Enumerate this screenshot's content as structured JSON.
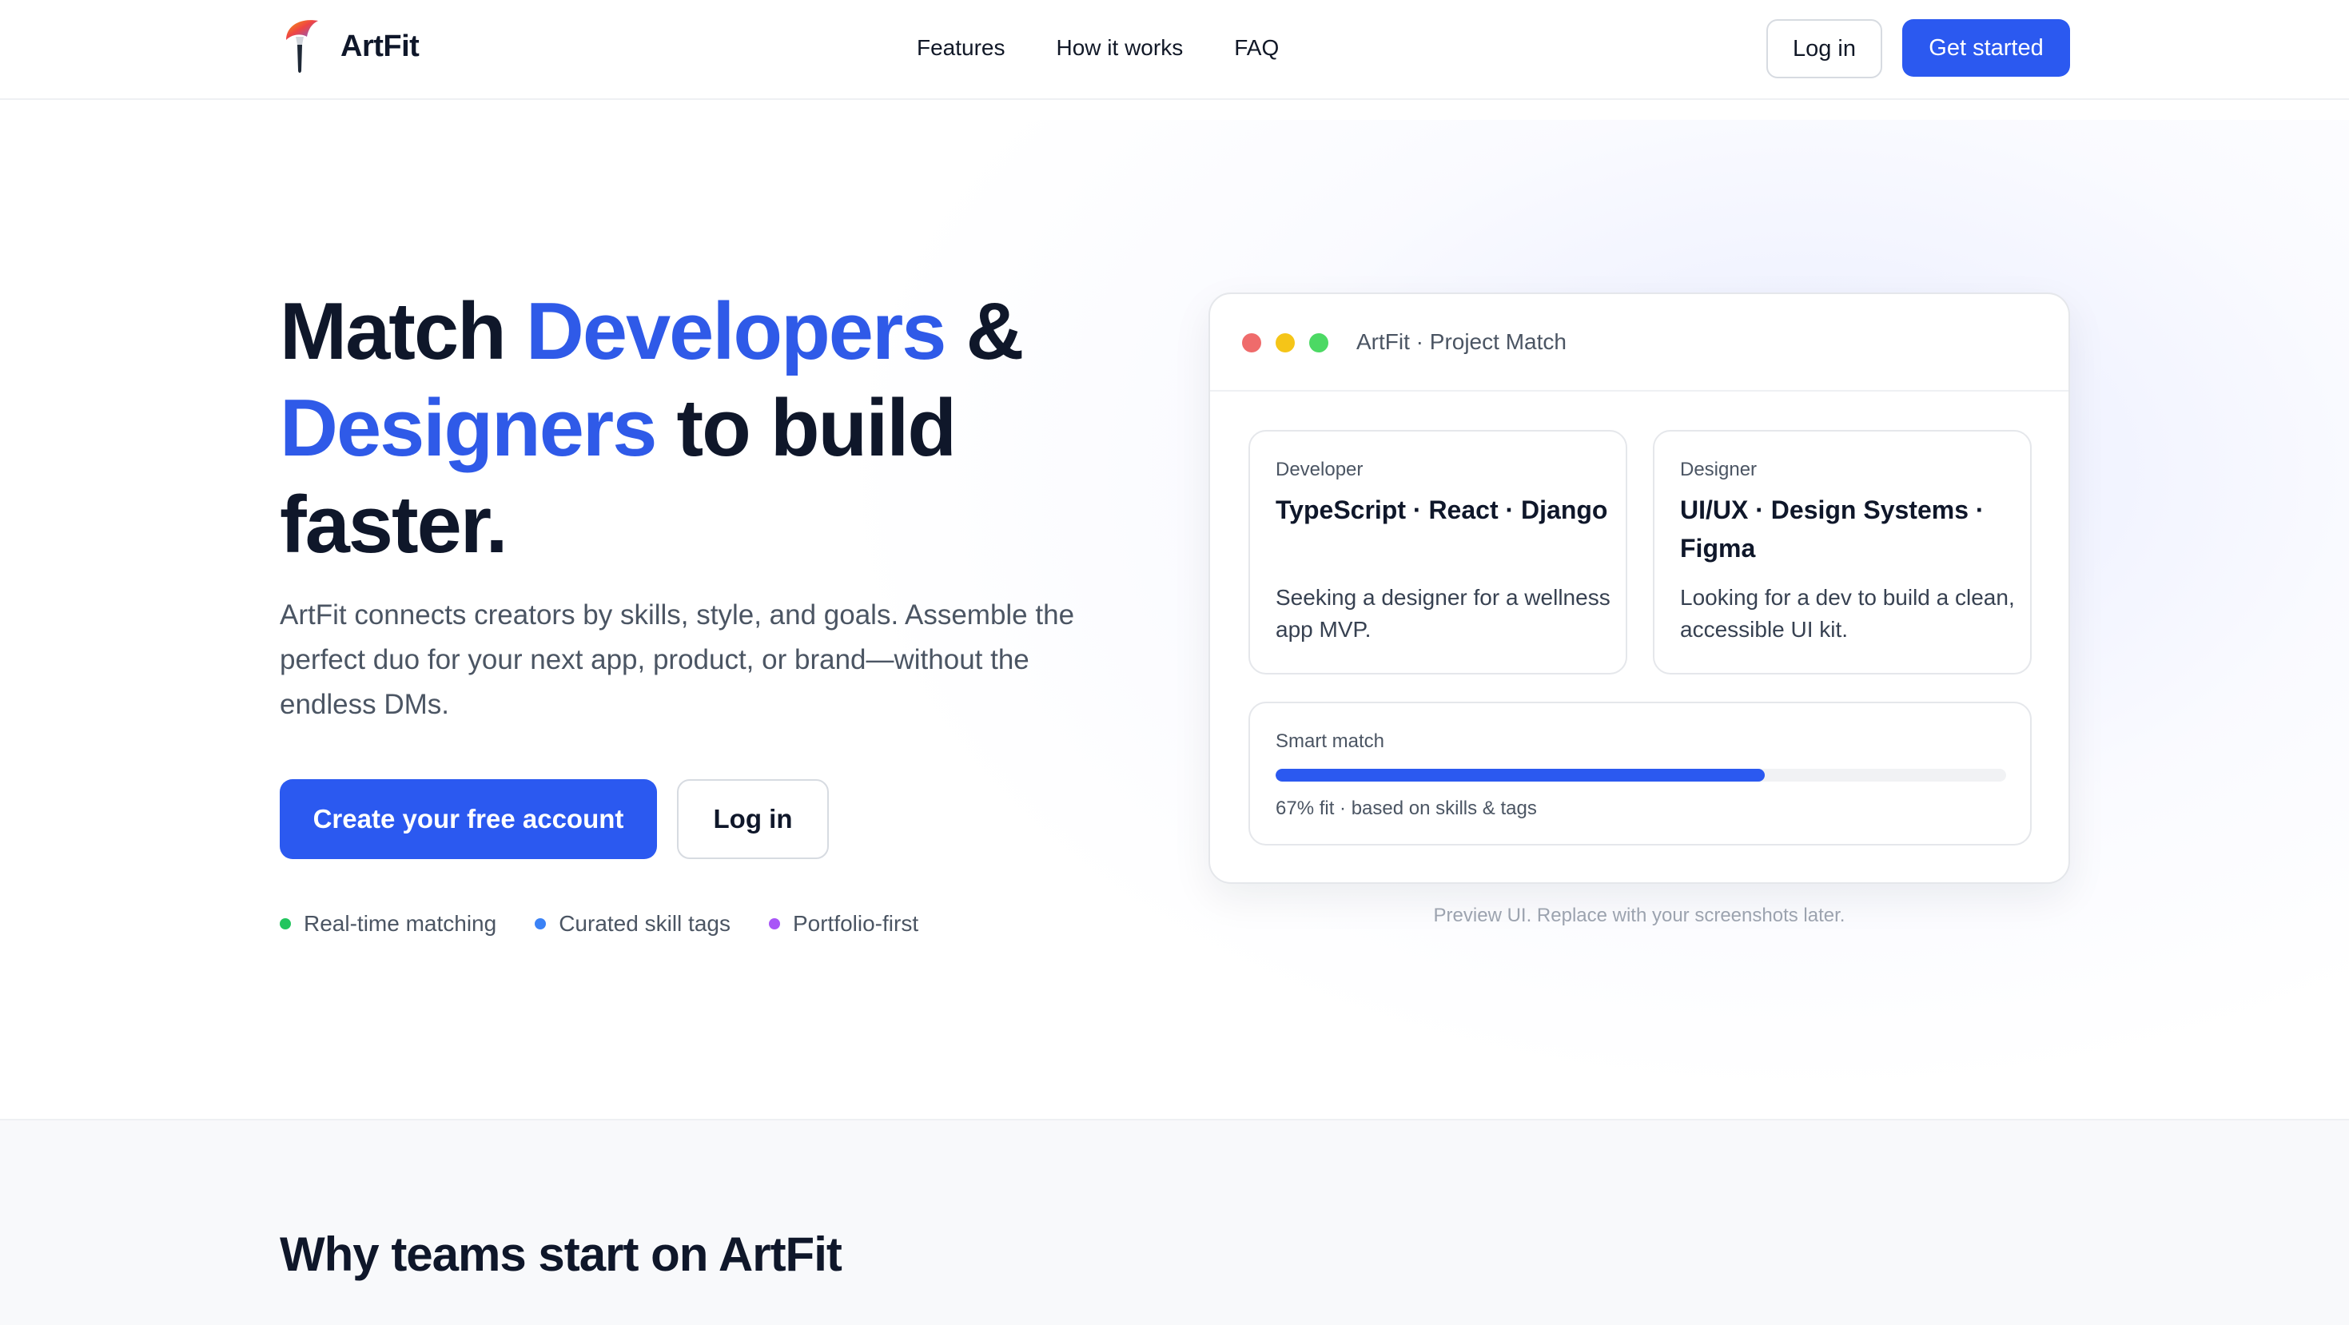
{
  "brand": {
    "name": "ArtFit",
    "logo_icon": "paintbrush-icon"
  },
  "nav": {
    "items": [
      "Features",
      "How it works",
      "FAQ"
    ]
  },
  "header": {
    "login_label": "Log in",
    "get_started_label": "Get started"
  },
  "hero": {
    "headline": {
      "p1": "Match ",
      "p2": "Developers",
      "p3": " &",
      "p4": "Designers",
      "p5": " to build",
      "p6": "faster."
    },
    "subtext": "ArtFit connects creators by skills, style, and goals. Assemble the perfect duo for your next app, product, or brand—without the endless DMs.",
    "cta_primary": "Create your free account",
    "cta_secondary": "Log in",
    "features": [
      {
        "label": "Real-time matching",
        "color": "#22c55e"
      },
      {
        "label": "Curated skill tags",
        "color": "#3b82f6"
      },
      {
        "label": "Portfolio-first",
        "color": "#a855f7"
      }
    ]
  },
  "preview": {
    "window_title": "ArtFit · Project Match",
    "window_dots": [
      "#ef6b6b",
      "#f5c518",
      "#4cd964"
    ],
    "developer": {
      "role": "Developer",
      "skills": "TypeScript · React · Django",
      "description": "Seeking a designer for a wellness app MVP."
    },
    "designer": {
      "role": "Designer",
      "skills": "UI/UX · Design Systems · Figma",
      "description": "Looking for a dev to build a clean, accessible UI kit."
    },
    "match": {
      "label": "Smart match",
      "percent": 67,
      "caption": "67% fit · based on skills & tags"
    },
    "caption": "Preview UI. Replace with your screenshots later."
  },
  "why": {
    "title": "Why teams start on ArtFit"
  },
  "colors": {
    "accent": "#2b59f0",
    "headline_blue": "#2f5ae8",
    "text_dark": "#0f172a"
  }
}
